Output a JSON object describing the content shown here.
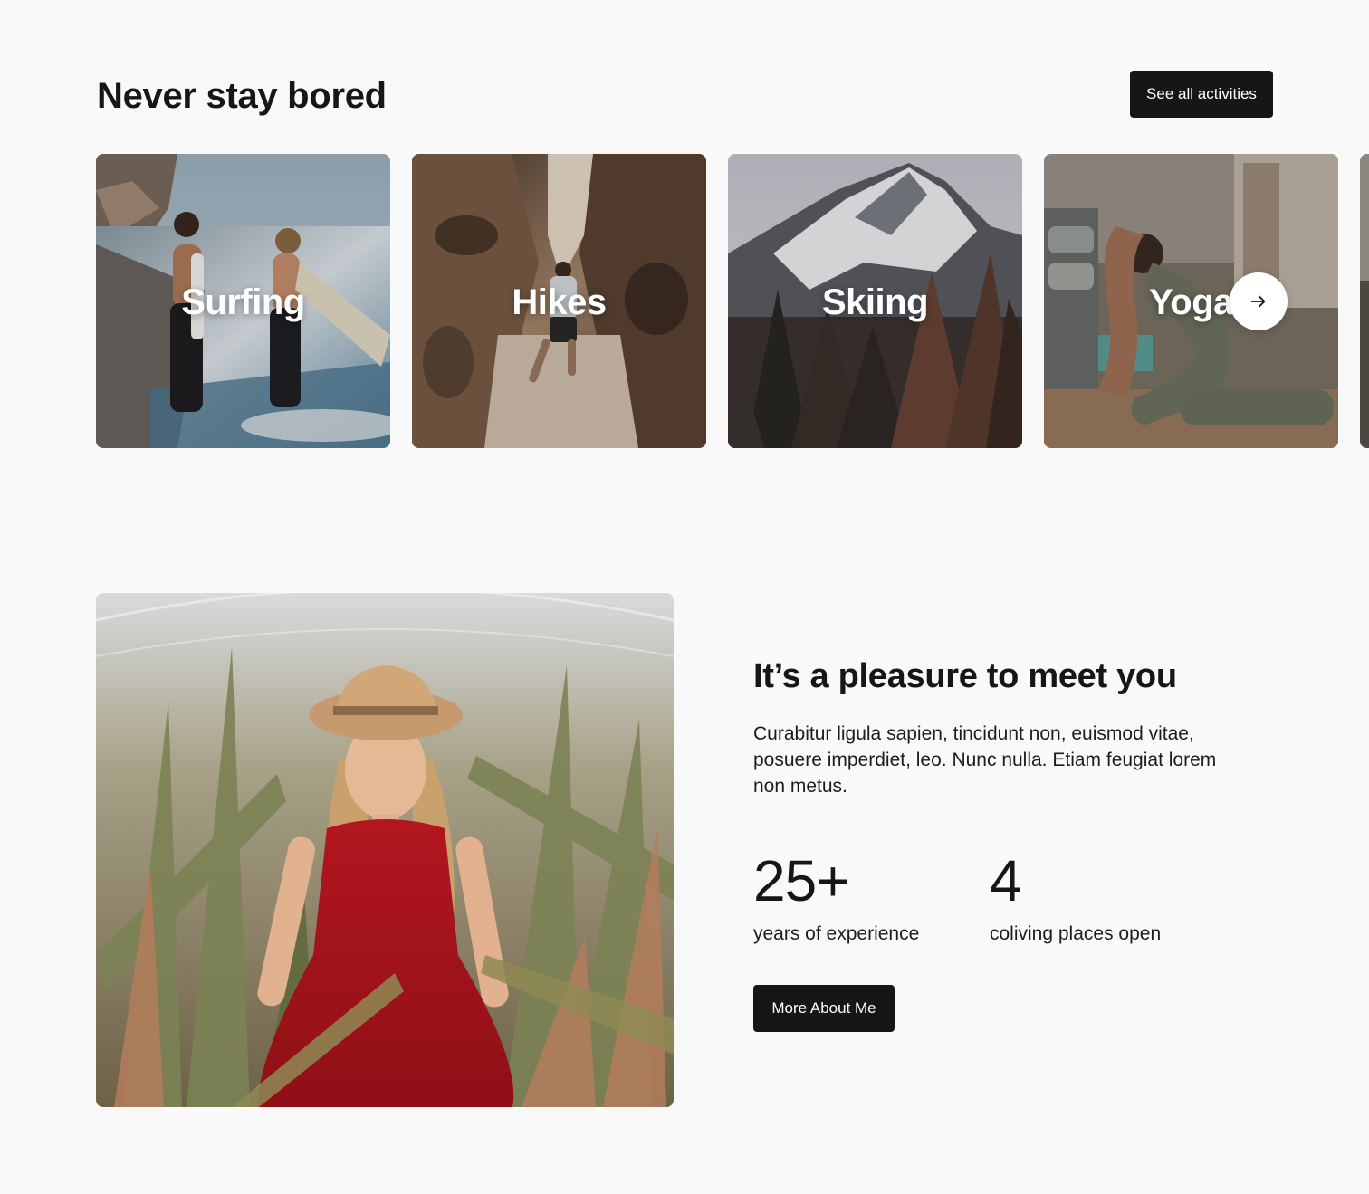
{
  "activities": {
    "title": "Never stay bored",
    "see_all_label": "See all activities",
    "cards": [
      {
        "label": "Surfing",
        "image": "beach-surfers-photo"
      },
      {
        "label": "Hikes",
        "image": "canyon-hiker-photo"
      },
      {
        "label": "Skiing",
        "image": "snowy-mountain-photo"
      },
      {
        "label": "Yoga",
        "image": "yoga-pose-photo"
      }
    ],
    "next_icon": "arrow-right-icon"
  },
  "about": {
    "image": "woman-in-red-dress-photo",
    "title": "It’s a pleasure to meet you",
    "body": "Curabitur ligula sapien, tincidunt non, euismod vitae, posuere imperdiet, leo. Nunc nulla. Etiam feugiat lorem non metus.",
    "stats": [
      {
        "value": "25+",
        "label": "years of experience"
      },
      {
        "value": "4",
        "label": "coliving places open"
      }
    ],
    "more_label": "More About Me"
  },
  "colors": {
    "background": "#f9f9f9",
    "text": "#161616",
    "button": "#161616",
    "button_text": "#ffffff"
  }
}
